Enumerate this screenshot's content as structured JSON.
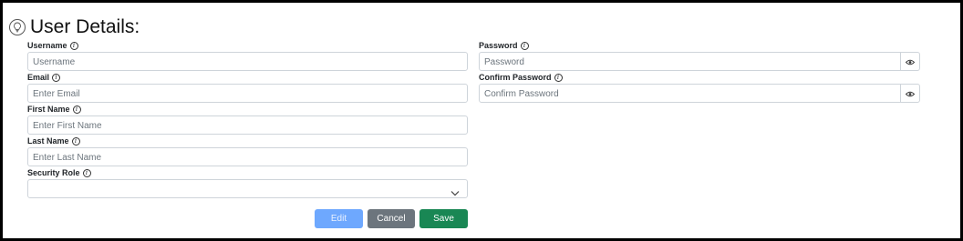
{
  "page": {
    "title": "User Details:"
  },
  "form": {
    "username": {
      "label": "Username",
      "placeholder": "Username",
      "value": ""
    },
    "email": {
      "label": "Email",
      "placeholder": "Enter Email",
      "value": ""
    },
    "first_name": {
      "label": "First Name",
      "placeholder": "Enter First Name",
      "value": ""
    },
    "last_name": {
      "label": "Last Name",
      "placeholder": "Enter Last Name",
      "value": ""
    },
    "security_role": {
      "label": "Security Role",
      "value": ""
    },
    "password": {
      "label": "Password",
      "placeholder": "Password",
      "value": ""
    },
    "confirm_password": {
      "label": "Confirm Password",
      "placeholder": "Confirm Password",
      "value": ""
    }
  },
  "buttons": {
    "edit": "Edit",
    "cancel": "Cancel",
    "save": "Save"
  },
  "icons": {
    "header": "lightbulb-icon",
    "info": "info-icon",
    "password_toggle": "eye-icon",
    "select": "chevron-down-icon"
  },
  "colors": {
    "edit_button": "#6ea8fe",
    "cancel_button": "#6c757d",
    "save_button": "#198754",
    "border": "#ced4da"
  }
}
